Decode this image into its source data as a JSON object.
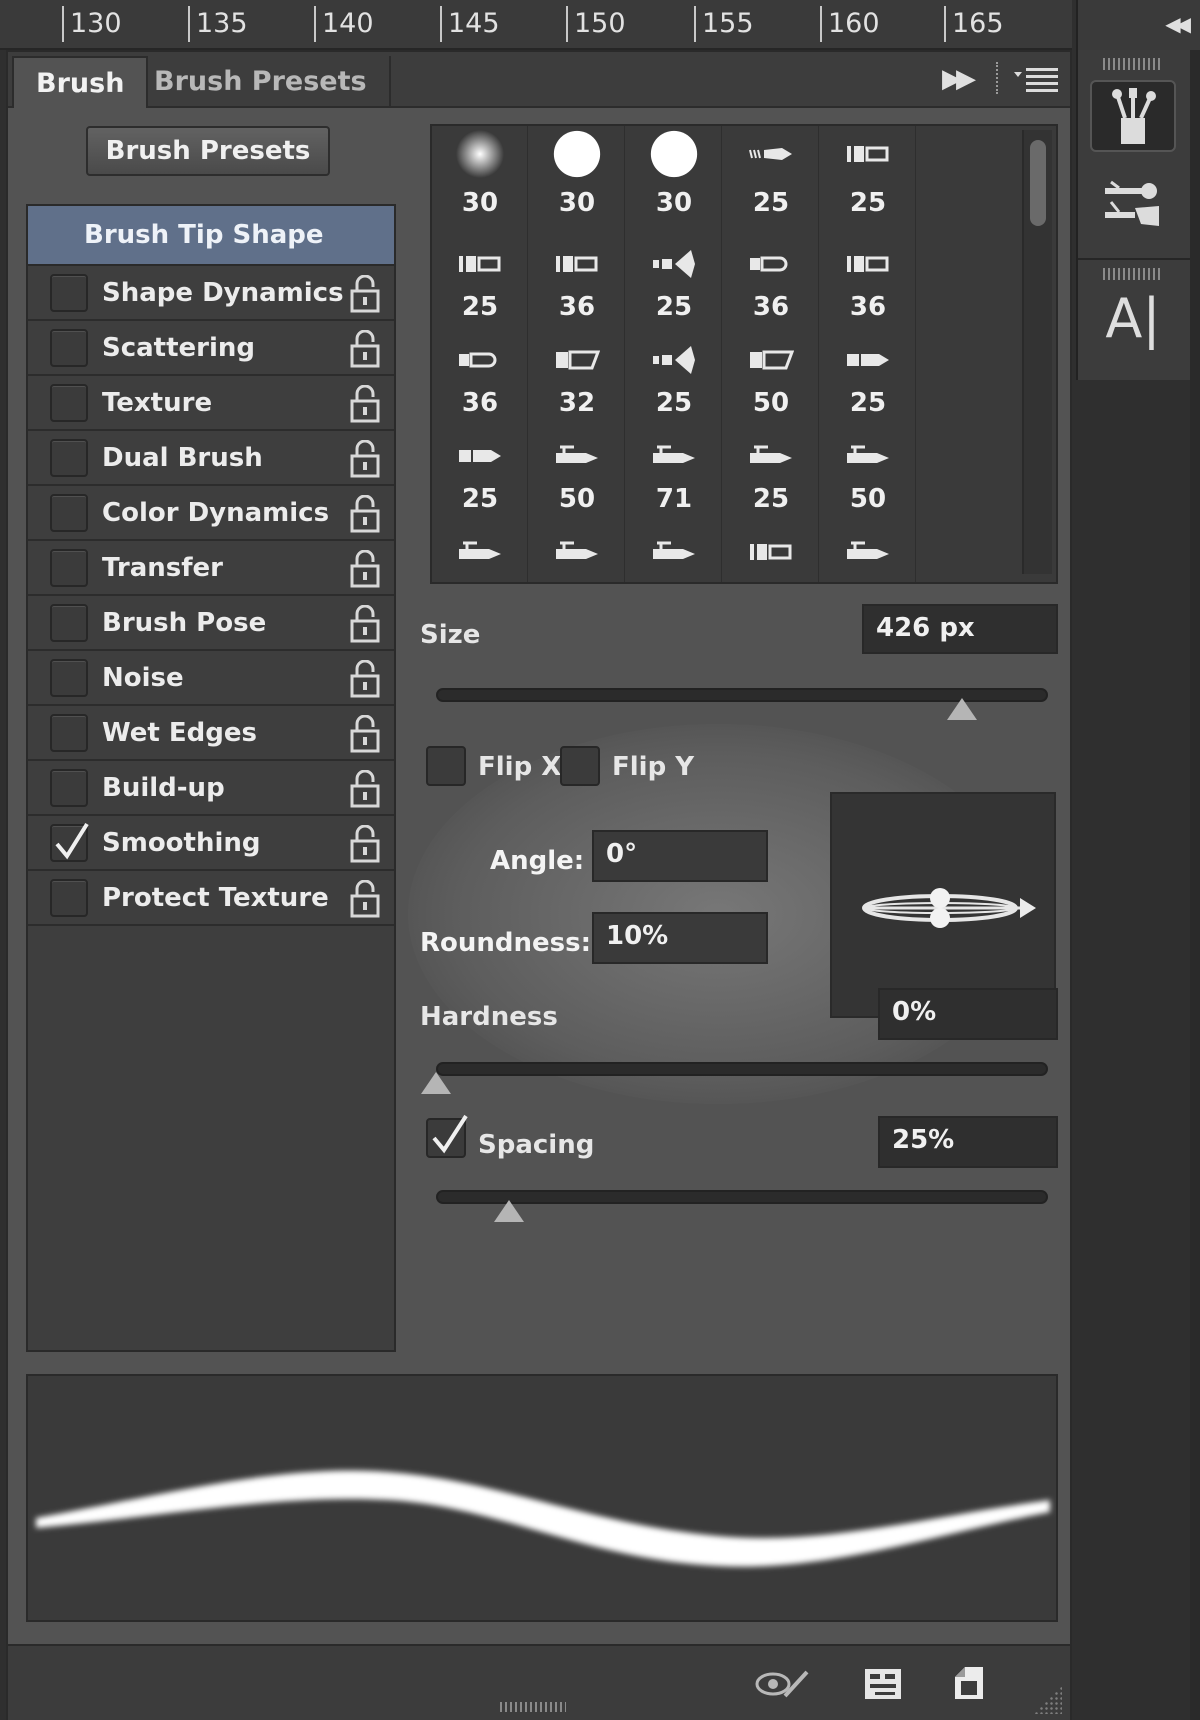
{
  "ruler": {
    "ticks": [
      "130",
      "135",
      "140",
      "145",
      "150",
      "155",
      "160",
      "165"
    ]
  },
  "dock": {
    "collapse_glyph": "◀◀",
    "buttons": [
      {
        "name": "brush-panel",
        "icon": "brushes-icon"
      },
      {
        "name": "brush-presets-panel",
        "icon": "brush-presets-icon"
      },
      {
        "name": "character-panel",
        "icon": "character-icon",
        "glyph": "A|"
      }
    ]
  },
  "tabs": {
    "brush": "Brush",
    "presets": "Brush Presets",
    "expand_glyph": "▶▶"
  },
  "presets_button": "Brush Presets",
  "tip_shape": "Brush Tip Shape",
  "options": [
    {
      "label": "Shape Dynamics",
      "checked": false
    },
    {
      "label": "Scattering",
      "checked": false
    },
    {
      "label": "Texture",
      "checked": false
    },
    {
      "label": "Dual Brush",
      "checked": false
    },
    {
      "label": "Color Dynamics",
      "checked": false
    },
    {
      "label": "Transfer",
      "checked": false
    },
    {
      "label": "Brush Pose",
      "checked": false
    },
    {
      "label": "Noise",
      "checked": false
    },
    {
      "label": "Wet Edges",
      "checked": false
    },
    {
      "label": "Build-up",
      "checked": false
    },
    {
      "label": "Smoothing",
      "checked": true
    },
    {
      "label": "Protect Texture",
      "checked": false
    }
  ],
  "tips": [
    {
      "size": "30",
      "kind": "soft"
    },
    {
      "size": "30",
      "kind": "hard"
    },
    {
      "size": "30",
      "kind": "hard"
    },
    {
      "size": "25",
      "kind": "bristle"
    },
    {
      "size": "25",
      "kind": "flat"
    },
    {
      "size": "25",
      "kind": "flat"
    },
    {
      "size": "36",
      "kind": "flat"
    },
    {
      "size": "25",
      "kind": "fan"
    },
    {
      "size": "36",
      "kind": "round-tip"
    },
    {
      "size": "36",
      "kind": "flat"
    },
    {
      "size": "36",
      "kind": "round-tip"
    },
    {
      "size": "32",
      "kind": "angle"
    },
    {
      "size": "25",
      "kind": "fan"
    },
    {
      "size": "50",
      "kind": "angle"
    },
    {
      "size": "25",
      "kind": "pencil"
    },
    {
      "size": "25",
      "kind": "pencil"
    },
    {
      "size": "50",
      "kind": "airbrush"
    },
    {
      "size": "71",
      "kind": "airbrush"
    },
    {
      "size": "25",
      "kind": "airbrush"
    },
    {
      "size": "50",
      "kind": "airbrush"
    },
    {
      "size": "",
      "kind": "airbrush"
    },
    {
      "size": "",
      "kind": "airbrush"
    },
    {
      "size": "",
      "kind": "airbrush"
    },
    {
      "size": "",
      "kind": "flat"
    },
    {
      "size": "",
      "kind": "airbrush"
    }
  ],
  "size": {
    "label": "Size",
    "value": "426 px",
    "level": 0.86
  },
  "flip": {
    "x_label": "Flip X",
    "y_label": "Flip Y",
    "x_checked": false,
    "y_checked": false
  },
  "angle": {
    "label": "Angle:",
    "value": "0°"
  },
  "roundness": {
    "label": "Roundness:",
    "value": "10%"
  },
  "hardness": {
    "label": "Hardness",
    "value": "0%",
    "level": 0
  },
  "spacing": {
    "label": "Spacing",
    "value": "25%",
    "checked": true,
    "level": 0.12
  },
  "bottom_bar": {
    "buttons": [
      {
        "name": "toggle-live-tip-preview",
        "icon": "brush-eye-icon"
      },
      {
        "name": "open-preset-manager",
        "icon": "grid-panel-icon"
      },
      {
        "name": "create-new-brush",
        "icon": "new-page-icon"
      }
    ]
  },
  "colors": {
    "panel_bg": "#535353",
    "highlight": "#60708a",
    "field_bg": "#2f2f2f",
    "text": "#ececec"
  }
}
